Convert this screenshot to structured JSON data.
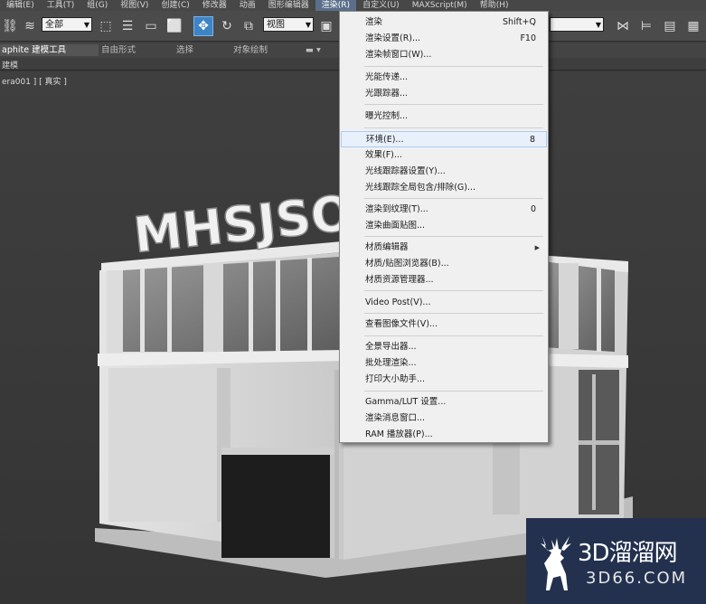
{
  "menubar": {
    "items": [
      "编辑(E)",
      "工具(T)",
      "组(G)",
      "视图(V)",
      "创建(C)",
      "修改器",
      "动画",
      "图形编辑器",
      "渲染(R)",
      "自定义(U)",
      "MAXScript(M)",
      "帮助(H)"
    ]
  },
  "toolbar": {
    "selection_filter": "全部",
    "ref_coord": "视图"
  },
  "ribbon": {
    "tabs": [
      "aphite 建模工具",
      "自由形式",
      "选择",
      "对象绘制"
    ],
    "panel_label": "建模"
  },
  "viewport": {
    "label": "era001 ] [ 真实 ]",
    "sign_text": "MHSJSOC"
  },
  "render_menu": {
    "items": [
      {
        "label": "渲染",
        "shortcut": "Shift+Q"
      },
      {
        "label": "渲染设置(R)...",
        "shortcut": "F10"
      },
      {
        "label": "渲染帧窗口(W)...",
        "shortcut": ""
      },
      {
        "label": "光能传递...",
        "shortcut": ""
      },
      {
        "label": "光跟踪器...",
        "shortcut": ""
      },
      {
        "label": "曝光控制...",
        "shortcut": ""
      },
      {
        "label": "环境(E)...",
        "shortcut": "8"
      },
      {
        "label": "效果(F)...",
        "shortcut": ""
      },
      {
        "label": "光线跟踪器设置(Y)...",
        "shortcut": ""
      },
      {
        "label": "光线跟踪全局包含/排除(G)...",
        "shortcut": ""
      },
      {
        "label": "渲染到纹理(T)...",
        "shortcut": "0"
      },
      {
        "label": "渲染曲面贴图...",
        "shortcut": ""
      },
      {
        "label": "材质编辑器",
        "shortcut": ""
      },
      {
        "label": "材质/贴图浏览器(B)...",
        "shortcut": ""
      },
      {
        "label": "材质资源管理器...",
        "shortcut": ""
      },
      {
        "label": "Video Post(V)...",
        "shortcut": ""
      },
      {
        "label": "查看图像文件(V)...",
        "shortcut": ""
      },
      {
        "label": "全景导出器...",
        "shortcut": ""
      },
      {
        "label": "批处理渲染...",
        "shortcut": ""
      },
      {
        "label": "打印大小助手...",
        "shortcut": ""
      },
      {
        "label": "Gamma/LUT 设置...",
        "shortcut": ""
      },
      {
        "label": "渲染消息窗口...",
        "shortcut": ""
      },
      {
        "label": "RAM 播放器(P)...",
        "shortcut": ""
      }
    ],
    "highlighted_index": 6
  },
  "watermark": {
    "title": "3D溜溜网",
    "url": "3D66.COM"
  },
  "colors": {
    "menu_bg": "#f0f0f0",
    "highlight": "#e8f1fb",
    "toolbar_selected": "#3d84c6",
    "watermark_bg": "#23314f"
  }
}
